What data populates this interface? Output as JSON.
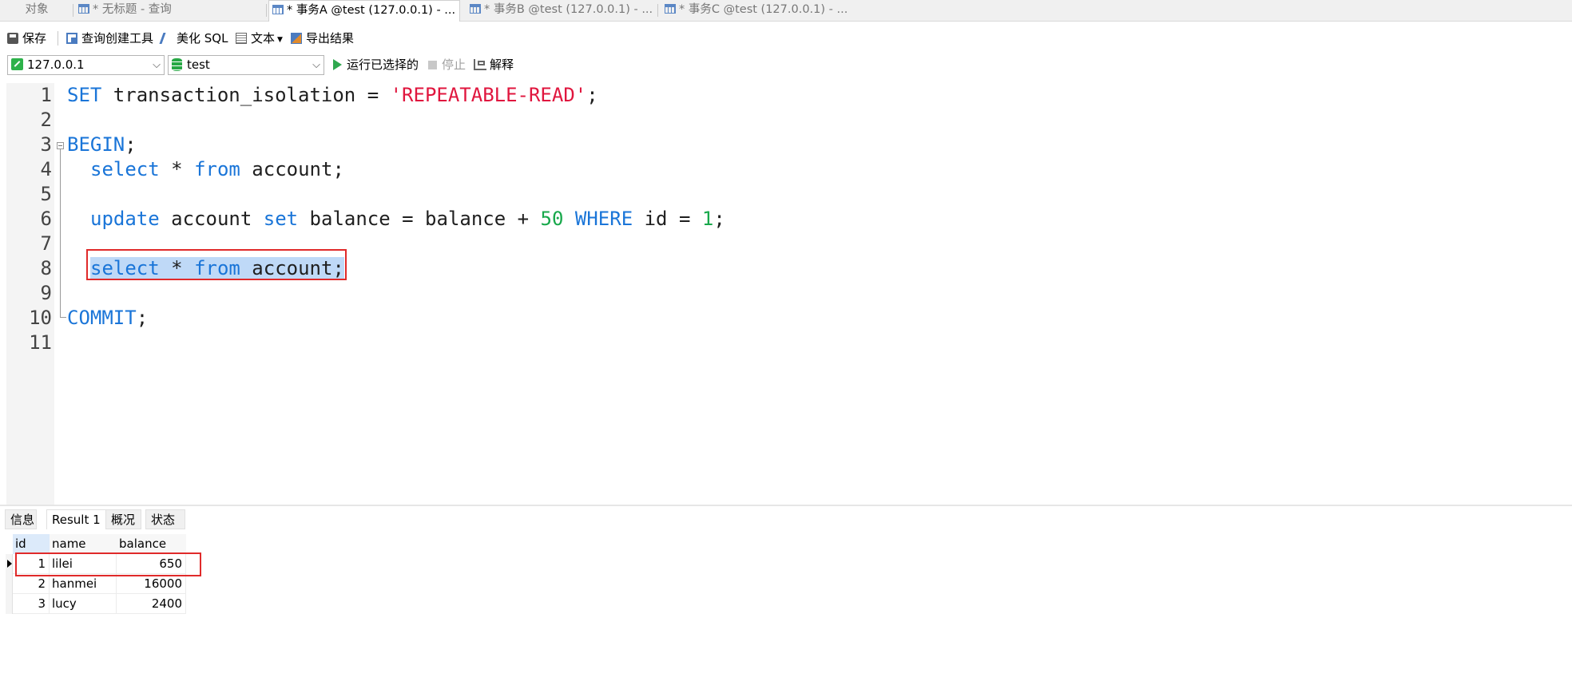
{
  "tabs": [
    {
      "label": "对象",
      "icon": "",
      "active": false
    },
    {
      "label": "* 无标题 - 查询",
      "icon": "table-icon",
      "active": false
    },
    {
      "label": "* 事务A @test (127.0.0.1) - ...",
      "icon": "table-icon",
      "active": true
    },
    {
      "label": "* 事务B @test (127.0.0.1) - ...",
      "icon": "table-icon",
      "active": false
    },
    {
      "label": "* 事务C @test (127.0.0.1) - ...",
      "icon": "table-icon",
      "active": false
    }
  ],
  "toolbar": {
    "save_label": "保存",
    "query_builder_label": "查询创建工具",
    "beautify_label": "美化 SQL",
    "text_label": "文本",
    "export_label": "导出结果"
  },
  "query_bar": {
    "connection": "127.0.0.1",
    "database": "test",
    "run_selected_label": "运行已选择的",
    "stop_label": "停止",
    "explain_label": "解释"
  },
  "editor": {
    "line_numbers": [
      "1",
      "2",
      "3",
      "4",
      "5",
      "6",
      "7",
      "8",
      "9",
      "10",
      "11"
    ],
    "lines": {
      "l1": {
        "kw1": "SET",
        "t1": " transaction_isolation = ",
        "str": "'REPEATABLE-READ'",
        "t2": ";"
      },
      "l3": {
        "kw1": "BEGIN",
        "t1": ";"
      },
      "l4": {
        "kw1": "select",
        "t1": " * ",
        "kw2": "from",
        "t2": " account;"
      },
      "l6": {
        "kw1": "update",
        "t1": " account ",
        "kw2": "set",
        "t2": " balance = balance + ",
        "num1": "50",
        "t3": " ",
        "kw3": "WHERE",
        "t4": " id = ",
        "num2": "1",
        "t5": ";"
      },
      "l8": {
        "kw1": "select",
        "t1": " * ",
        "kw2": "from",
        "t2": " account;"
      },
      "l10": {
        "kw1": "COMMIT",
        "t1": ";"
      }
    }
  },
  "results": {
    "tabs": [
      "信息",
      "Result 1",
      "概况",
      "状态"
    ],
    "active_tab": "Result 1",
    "columns": [
      "id",
      "name",
      "balance"
    ],
    "rows": [
      [
        "1",
        "lilei",
        "650"
      ],
      [
        "2",
        "hanmei",
        "16000"
      ],
      [
        "3",
        "lucy",
        "2400"
      ]
    ]
  },
  "colors": {
    "keyword": "#1a75d8",
    "string": "#e0163e",
    "number": "#18a84b",
    "highlight_box": "#e02a2a",
    "selection": "#bfd9f7"
  }
}
